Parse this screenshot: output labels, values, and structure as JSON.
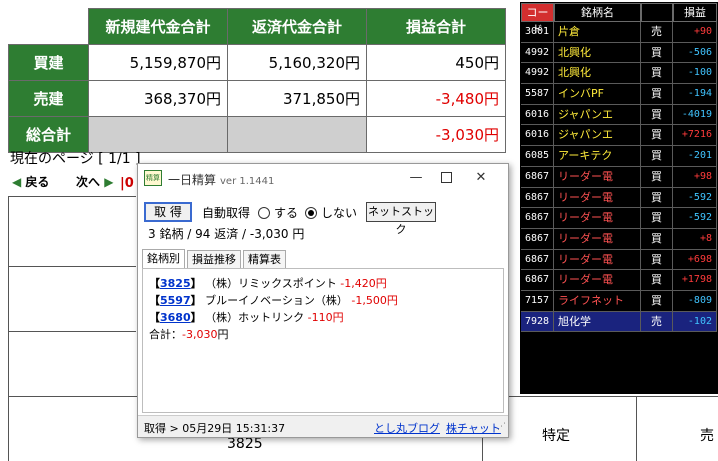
{
  "summary": {
    "headers": [
      "新規建代金合計",
      "返済代金合計",
      "損益合計"
    ],
    "rows": [
      {
        "label": "買建",
        "new": "5,159,870円",
        "close": "5,160,320円",
        "pl": "450円"
      },
      {
        "label": "売建",
        "new": "368,370円",
        "close": "371,850円",
        "pl": "-3,480円"
      },
      {
        "label": "総合計",
        "new": "",
        "close": "",
        "pl": "-3,030円"
      }
    ]
  },
  "page_status": "現在のページ [ 1/1 ]",
  "nav": {
    "prev": "戻る",
    "next": "次へ",
    "cut": "0"
  },
  "bg": {
    "code": "3825",
    "tokutei": "特定",
    "sell": "売"
  },
  "stock_panel": {
    "headers": {
      "code": "コード",
      "name": "銘柄名",
      "side": "",
      "pl": "損益"
    },
    "rows": [
      {
        "code": "3001",
        "name": "片倉",
        "side": "売",
        "pl": "+90",
        "name_color": "#ffeb3b",
        "pl_color": "#ff3b3b"
      },
      {
        "code": "4992",
        "name": "北興化",
        "side": "買",
        "pl": "-506",
        "name_color": "#ffeb3b",
        "pl_color": "#40c4ff"
      },
      {
        "code": "4992",
        "name": "北興化",
        "side": "買",
        "pl": "-100",
        "name_color": "#ffeb3b",
        "pl_color": "#40c4ff"
      },
      {
        "code": "5587",
        "name": "インバPF",
        "side": "買",
        "pl": "-194",
        "name_color": "#ffeb3b",
        "pl_color": "#40c4ff"
      },
      {
        "code": "6016",
        "name": "ジャパンエ",
        "side": "買",
        "pl": "-4019",
        "name_color": "#ffeb3b",
        "pl_color": "#40c4ff"
      },
      {
        "code": "6016",
        "name": "ジャパンエ",
        "side": "買",
        "pl": "+7216",
        "name_color": "#ffeb3b",
        "pl_color": "#ff3b3b"
      },
      {
        "code": "6085",
        "name": "アーキテク",
        "side": "買",
        "pl": "-201",
        "name_color": "#ffeb3b",
        "pl_color": "#40c4ff"
      },
      {
        "code": "6867",
        "name": "リーダー電",
        "side": "買",
        "pl": "+98",
        "name_color": "#ff5252",
        "pl_color": "#ff3b3b"
      },
      {
        "code": "6867",
        "name": "リーダー電",
        "side": "買",
        "pl": "-592",
        "name_color": "#ff5252",
        "pl_color": "#40c4ff"
      },
      {
        "code": "6867",
        "name": "リーダー電",
        "side": "買",
        "pl": "-592",
        "name_color": "#ff5252",
        "pl_color": "#40c4ff"
      },
      {
        "code": "6867",
        "name": "リーダー電",
        "side": "買",
        "pl": "+8",
        "name_color": "#ff5252",
        "pl_color": "#ff3b3b"
      },
      {
        "code": "6867",
        "name": "リーダー電",
        "side": "買",
        "pl": "+698",
        "name_color": "#ff5252",
        "pl_color": "#ff3b3b"
      },
      {
        "code": "6867",
        "name": "リーダー電",
        "side": "買",
        "pl": "+1798",
        "name_color": "#ff5252",
        "pl_color": "#ff3b3b"
      },
      {
        "code": "7157",
        "name": "ライフネット",
        "side": "買",
        "pl": "-809",
        "name_color": "#ff5252",
        "pl_color": "#40c4ff"
      },
      {
        "code": "7928",
        "name": "旭化学",
        "side": "売",
        "pl": "-102",
        "name_color": "#ffffff",
        "pl_color": "#40c4ff",
        "selected": true
      }
    ]
  },
  "window": {
    "icon_text": "精算",
    "title": "一日精算",
    "version": "ver 1.1441",
    "fetch_button": "取 得",
    "auto_label": "自動取得",
    "radio_on": "する",
    "radio_off": "しない",
    "net_button": "ネットストック",
    "status_line": "3 銘柄 / 94 返済 / -3,030 円",
    "tabs": [
      "銘柄別",
      "損益推移",
      "精算表"
    ],
    "positions": [
      {
        "code": "3825",
        "name": "（株）リミックスポイント",
        "pl": "-1,420円"
      },
      {
        "code": "5597",
        "name": "ブルーイノベーション（株）",
        "pl": "-1,500円"
      },
      {
        "code": "3680",
        "name": "（株）ホットリンク",
        "pl": "-110円"
      }
    ],
    "total_label": "合計：",
    "total_value": "-3,030",
    "total_unit": "円",
    "status_time": "取得 > 05月29日 15:31:37",
    "link_blog": "とし丸ブログ",
    "link_chart": "株チャット"
  },
  "colors": {
    "green": "#2e7d32",
    "loss": "#e00000",
    "link": "#0033cc"
  }
}
